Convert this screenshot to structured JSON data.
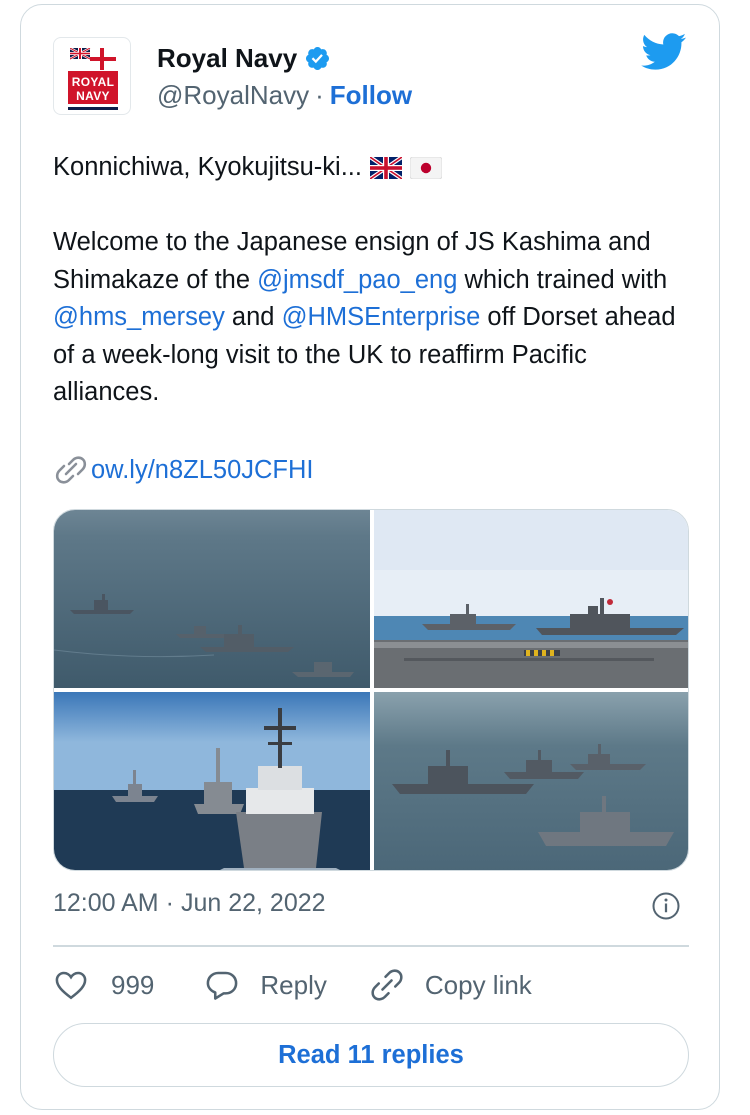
{
  "author": {
    "name": "Royal Navy",
    "handle": "@RoyalNavy",
    "separator": "·",
    "follow_label": "Follow",
    "avatar_text_line1": "ROYAL",
    "avatar_text_line2": "NAVY",
    "verified_icon": "verified-badge-icon"
  },
  "brand": {
    "twitter_icon": "twitter-bird-icon",
    "accent": "#1d9bf0",
    "link": "#1d6fd6"
  },
  "tweet": {
    "line1": "Konnichiwa, Kyokujitsu-ki...",
    "flags": [
      "uk-flag-icon",
      "japan-flag-icon"
    ],
    "p_intro": "Welcome to the Japanese ensign of JS Kashima and Shimakaze of the ",
    "mention1": "@jmsdf_pao_eng",
    "p_mid1": " which trained with ",
    "mention2": "@hms_mersey",
    "p_mid2": " and ",
    "mention3": "@HMSEnterprise",
    "p_end": " off Dorset ahead of a week-long visit to the UK to reaffirm Pacific  alliances.",
    "link": "ow.ly/n8ZL50JCFHI"
  },
  "media": [
    {
      "name": "photo-ships-formation-open-sea"
    },
    {
      "name": "photo-ships-from-carrier-deck"
    },
    {
      "name": "photo-patrol-ship-leading-column"
    },
    {
      "name": "photo-ships-in-line-ahead"
    }
  ],
  "meta": {
    "time": "12:00 AM",
    "separator": "·",
    "date": "Jun 22, 2022"
  },
  "actions": {
    "like_count": "999",
    "reply_label": "Reply",
    "copy_label": "Copy link"
  },
  "read_replies_label": "Read 11 replies"
}
